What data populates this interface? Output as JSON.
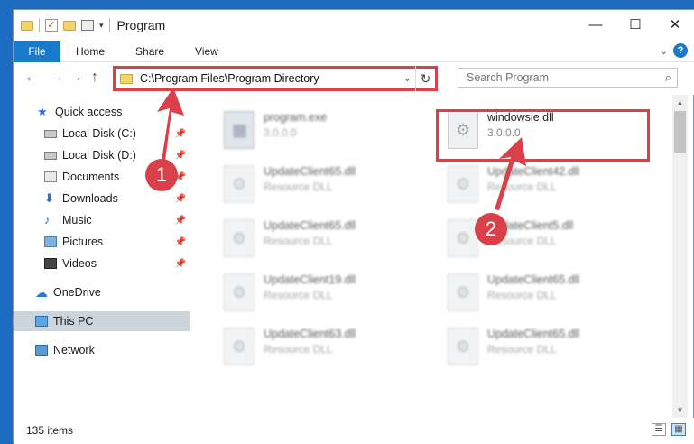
{
  "window": {
    "title": "Program"
  },
  "ribbon": {
    "file": "File",
    "tabs": [
      "Home",
      "Share",
      "View"
    ]
  },
  "address": {
    "path": "C:\\Program Files\\Program Directory"
  },
  "search": {
    "placeholder": "Search Program"
  },
  "sidebar": {
    "items": [
      {
        "label": "Quick access",
        "icon": "star-icon"
      },
      {
        "label": "Local Disk (C:)",
        "icon": "disk-icon",
        "pinned": true
      },
      {
        "label": "Local Disk (D:)",
        "icon": "disk-icon",
        "pinned": true
      },
      {
        "label": "Documents",
        "icon": "documents-icon",
        "pinned": true
      },
      {
        "label": "Downloads",
        "icon": "download-icon",
        "pinned": true
      },
      {
        "label": "Music",
        "icon": "music-icon",
        "pinned": true
      },
      {
        "label": "Pictures",
        "icon": "pictures-icon",
        "pinned": true
      },
      {
        "label": "Videos",
        "icon": "videos-icon",
        "pinned": true
      },
      {
        "label": "OneDrive",
        "icon": "onedrive-icon"
      },
      {
        "label": "This PC",
        "icon": "pc-icon",
        "selected": true
      },
      {
        "label": "Network",
        "icon": "network-icon"
      }
    ]
  },
  "files": [
    {
      "name": "program.exe",
      "desc": "3.0.0.0"
    },
    {
      "name": "windowsie.dll",
      "desc": "3.0.0.0"
    },
    {
      "name": "UpdateClient65.dll",
      "desc": "Resource DLL"
    },
    {
      "name": "UpdateClient42.dll",
      "desc": "Resource DLL"
    },
    {
      "name": "UpdateClient65.dll",
      "desc": "Resource DLL"
    },
    {
      "name": "UpdateClient5.dll",
      "desc": "Resource DLL"
    },
    {
      "name": "UpdateClient19.dll",
      "desc": "Resource DLL"
    },
    {
      "name": "UpdateClient65.dll",
      "desc": "Resource DLL"
    },
    {
      "name": "UpdateClient63.dll",
      "desc": "Resource DLL"
    },
    {
      "name": "UpdateClient65.dll",
      "desc": "Resource DLL"
    }
  ],
  "status": {
    "count": "135 items"
  },
  "markers": {
    "one": "1",
    "two": "2"
  },
  "colors": {
    "accent": "#1979ca",
    "highlight": "#d9404a",
    "desktop": "#1e6cc0"
  }
}
